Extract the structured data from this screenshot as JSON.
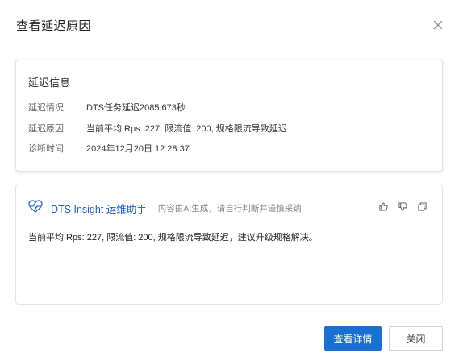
{
  "dialog": {
    "title": "查看延迟原因"
  },
  "delay_info": {
    "title": "延迟信息",
    "rows": [
      {
        "label": "延迟情况",
        "value": "DTS任务延迟2085.673秒"
      },
      {
        "label": "延迟原因",
        "value": "当前平均 Rps: 227, 限流值: 200, 规格限流导致延迟"
      },
      {
        "label": "诊断时间",
        "value": "2024年12月20日 12:28:37"
      }
    ]
  },
  "insight": {
    "title": "DTS Insight 运维助手",
    "hint": "内容由AI生成，请自行判断并谨慎采纳",
    "body": "当前平均 Rps: 227, 限流值: 200, 规格限流导致延迟，建议升级规格解决。",
    "accent_color": "#1b5bd0"
  },
  "footer": {
    "details_label": "查看详情",
    "close_label": "关闭",
    "primary_color": "#1a6fd2"
  }
}
